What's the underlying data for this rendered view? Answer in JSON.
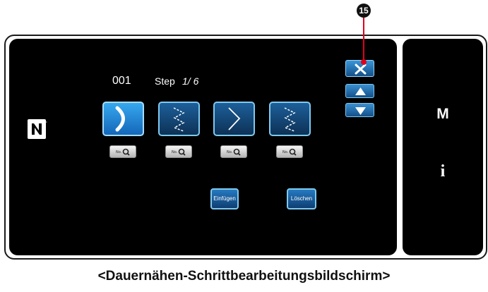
{
  "header": {
    "program_number": "001",
    "step_label": "Step",
    "step_counter": "1/ 6"
  },
  "pattern_buttons": [
    {
      "icon": "curve-stitch-icon",
      "selected": true
    },
    {
      "icon": "zigzag-stitch-icon",
      "selected": false
    },
    {
      "icon": "zigzag-stitch-icon",
      "selected": false
    },
    {
      "icon": "zigzag-stitch-icon",
      "selected": false
    }
  ],
  "pattern_search": {
    "label": "No.",
    "icon": "magnifier-icon"
  },
  "buttons": {
    "close_icon": "close-icon",
    "up_icon": "arrow-up-icon",
    "down_icon": "arrow-down-icon",
    "insert_label": "Einfügen",
    "delete_label": "Löschen"
  },
  "side_panel": {
    "mode_label": "M",
    "info_label": "i"
  },
  "nfc_icon": "nfc-icon",
  "callout": {
    "number": "15"
  },
  "caption": "<Dauernähen-Schrittbearbeitungsbildschirm>",
  "colors": {
    "panel": "#000000",
    "button_blue": "#1d5f9a",
    "selected_blue": "#36a8f0",
    "button_border": "#7fc9ef",
    "callout_red": "#e0001b"
  }
}
